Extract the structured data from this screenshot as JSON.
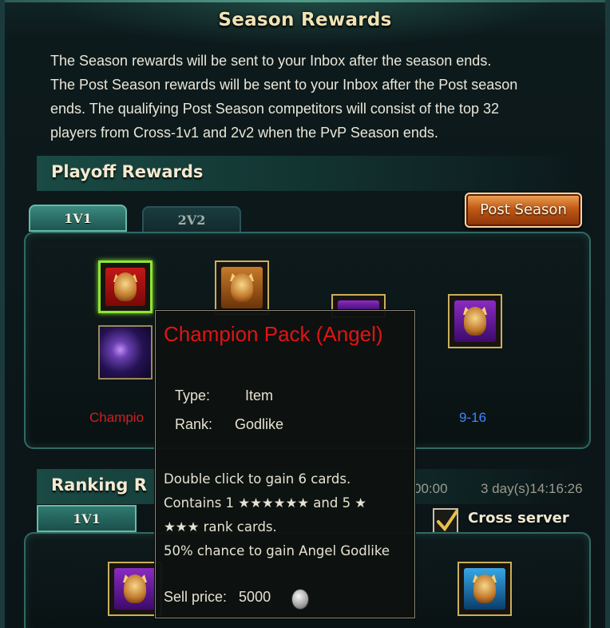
{
  "window": {
    "title": "Season Rewards"
  },
  "intro": {
    "line1": "The Season rewards will be sent to your Inbox after the season ends.",
    "line2": "The Post Season rewards will be sent to your Inbox after the Post season",
    "line3": "ends. The qualifying Post Season competitors will consist of the top 32",
    "line4": "players from Cross-1v1 and 2v2 when the PvP Season ends."
  },
  "playoff": {
    "title": "Playoff Rewards",
    "tabs": [
      {
        "label": "1V1"
      },
      {
        "label": "2V2"
      }
    ],
    "post_season_button": "Post Season",
    "labels": {
      "champion": "Champio",
      "rank_9_16": "9-16"
    }
  },
  "ranking": {
    "title": "Ranking R",
    "tab": "1V1",
    "timer1": "00:00",
    "timer2": "3 day(s)14:16:26",
    "cross_server_label": "Cross server",
    "cross_server_checked": true
  },
  "tooltip": {
    "title": "Champion Pack (Angel)",
    "type_label": "Type:",
    "type_value": "Item",
    "rank_label": "Rank:",
    "rank_value": "Godlike",
    "desc1": "Double click to gain 6 cards.",
    "desc2": "Contains 1 ★★★★★★ and 5 ★",
    "desc3": "★★★ rank cards.",
    "desc4": "50% chance to gain Angel Godlike",
    "sell_label": "Sell price:",
    "sell_value": "5000"
  },
  "colors": {
    "accent": "#2f6a64",
    "title_red": "#e01414",
    "rank_blue": "#3d86ff",
    "selected_green": "#8de633"
  }
}
